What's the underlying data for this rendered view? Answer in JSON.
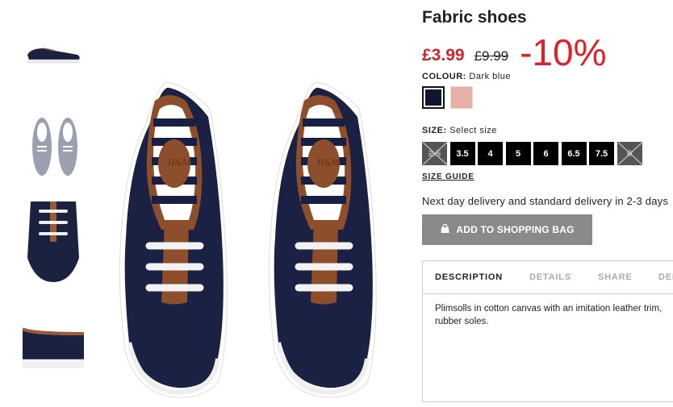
{
  "product": {
    "title": "Fabric shoes",
    "price_now": "£3.99",
    "price_old": "£9.99",
    "discount": "-10%"
  },
  "colour": {
    "label": "COLOUR:",
    "value": "Dark blue",
    "swatches": [
      {
        "name": "navy",
        "color": "#0f1730"
      },
      {
        "name": "pink",
        "color": "#e6b0a6"
      }
    ]
  },
  "size": {
    "label": "SIZE:",
    "value": "Select size",
    "options": [
      "2.5",
      "3.5",
      "4",
      "5",
      "6",
      "6.5",
      "7.5",
      "8"
    ]
  },
  "size_guide": "SIZE GUIDE",
  "delivery": "Next day delivery and standard delivery in 2-3 days",
  "add_button": "ADD TO SHOPPING BAG",
  "tabs": [
    "DESCRIPTION",
    "DETAILS",
    "SHARE",
    "DEL"
  ],
  "description": "Plimsolls in cotton canvas with an imitation leather trim, rubber soles.",
  "colors": {
    "sale_red": "#e31e24",
    "button_grey": "#8a8a8a"
  },
  "icons": [
    "shopping-bag-icon"
  ]
}
